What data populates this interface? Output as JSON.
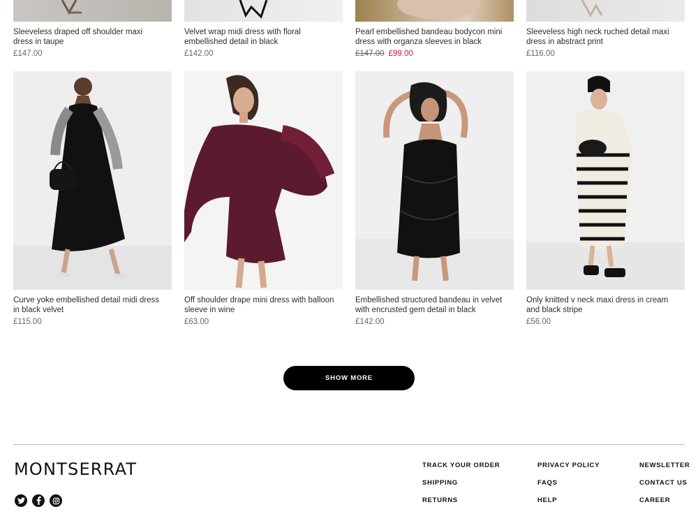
{
  "products_top": [
    {
      "title": "Sleeveless draped off shoulder maxi dress in taupe",
      "price": "£147.00"
    },
    {
      "title": "Velvet wrap midi dress with floral embellished detail in black",
      "price": "£142.00"
    },
    {
      "title": "Pearl embellished bandeau bodycon mini dress with organza sleeves in black",
      "old_price": "£147.00",
      "sale_price": "£99.00"
    },
    {
      "title": "Sleeveless high neck ruched detail maxi dress in abstract print",
      "price": "£116.00"
    }
  ],
  "products_bottom": [
    {
      "title": "Curve yoke embellished detail midi dress in black velvet",
      "price": "£115.00"
    },
    {
      "title": "Off shoulder drape mini dress with balloon sleeve in wine",
      "price": "£63.00"
    },
    {
      "title": "Embellished structured bandeau in velvet with encrusted gem detail in black",
      "price": "£142.00"
    },
    {
      "title": "Only knitted v neck maxi dress in cream and black stripe",
      "price": "£56.00"
    }
  ],
  "show_more_label": "SHOW MORE",
  "footer": {
    "brand": "MONTSERRAT",
    "social_icons": [
      "twitter-icon",
      "facebook-icon",
      "instagram-icon"
    ],
    "col1": [
      "TRACK YOUR ORDER",
      "SHIPPING",
      "RETURNS"
    ],
    "col2": [
      "PRIVACY POLICY",
      "FAQS",
      "HELP"
    ],
    "col3": [
      "NEWSLETTER",
      "CONTACT US",
      "CAREER"
    ]
  },
  "colors": {
    "sale": "#d01345",
    "button": "#000000",
    "text": "#2d2d2d",
    "muted": "#666666"
  }
}
